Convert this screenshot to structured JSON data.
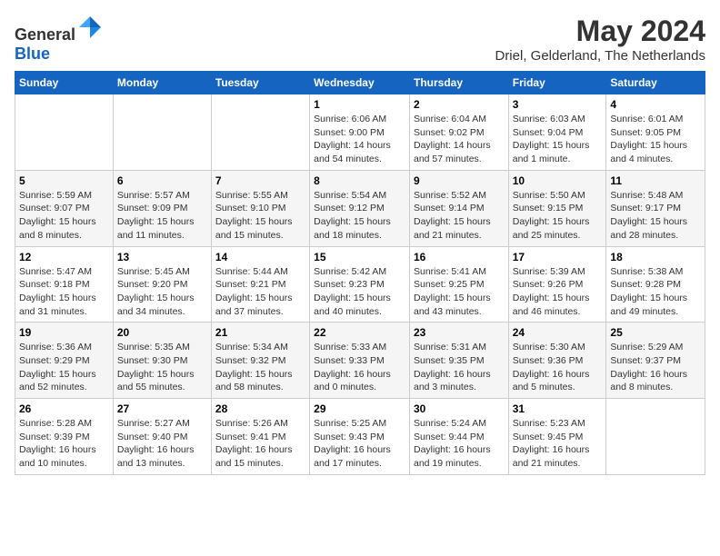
{
  "logo": {
    "general": "General",
    "blue": "Blue"
  },
  "title": "May 2024",
  "location": "Driel, Gelderland, The Netherlands",
  "weekdays": [
    "Sunday",
    "Monday",
    "Tuesday",
    "Wednesday",
    "Thursday",
    "Friday",
    "Saturday"
  ],
  "weeks": [
    [
      {
        "day": "",
        "info": ""
      },
      {
        "day": "",
        "info": ""
      },
      {
        "day": "",
        "info": ""
      },
      {
        "day": "1",
        "info": "Sunrise: 6:06 AM\nSunset: 9:00 PM\nDaylight: 14 hours\nand 54 minutes."
      },
      {
        "day": "2",
        "info": "Sunrise: 6:04 AM\nSunset: 9:02 PM\nDaylight: 14 hours\nand 57 minutes."
      },
      {
        "day": "3",
        "info": "Sunrise: 6:03 AM\nSunset: 9:04 PM\nDaylight: 15 hours\nand 1 minute."
      },
      {
        "day": "4",
        "info": "Sunrise: 6:01 AM\nSunset: 9:05 PM\nDaylight: 15 hours\nand 4 minutes."
      }
    ],
    [
      {
        "day": "5",
        "info": "Sunrise: 5:59 AM\nSunset: 9:07 PM\nDaylight: 15 hours\nand 8 minutes."
      },
      {
        "day": "6",
        "info": "Sunrise: 5:57 AM\nSunset: 9:09 PM\nDaylight: 15 hours\nand 11 minutes."
      },
      {
        "day": "7",
        "info": "Sunrise: 5:55 AM\nSunset: 9:10 PM\nDaylight: 15 hours\nand 15 minutes."
      },
      {
        "day": "8",
        "info": "Sunrise: 5:54 AM\nSunset: 9:12 PM\nDaylight: 15 hours\nand 18 minutes."
      },
      {
        "day": "9",
        "info": "Sunrise: 5:52 AM\nSunset: 9:14 PM\nDaylight: 15 hours\nand 21 minutes."
      },
      {
        "day": "10",
        "info": "Sunrise: 5:50 AM\nSunset: 9:15 PM\nDaylight: 15 hours\nand 25 minutes."
      },
      {
        "day": "11",
        "info": "Sunrise: 5:48 AM\nSunset: 9:17 PM\nDaylight: 15 hours\nand 28 minutes."
      }
    ],
    [
      {
        "day": "12",
        "info": "Sunrise: 5:47 AM\nSunset: 9:18 PM\nDaylight: 15 hours\nand 31 minutes."
      },
      {
        "day": "13",
        "info": "Sunrise: 5:45 AM\nSunset: 9:20 PM\nDaylight: 15 hours\nand 34 minutes."
      },
      {
        "day": "14",
        "info": "Sunrise: 5:44 AM\nSunset: 9:21 PM\nDaylight: 15 hours\nand 37 minutes."
      },
      {
        "day": "15",
        "info": "Sunrise: 5:42 AM\nSunset: 9:23 PM\nDaylight: 15 hours\nand 40 minutes."
      },
      {
        "day": "16",
        "info": "Sunrise: 5:41 AM\nSunset: 9:25 PM\nDaylight: 15 hours\nand 43 minutes."
      },
      {
        "day": "17",
        "info": "Sunrise: 5:39 AM\nSunset: 9:26 PM\nDaylight: 15 hours\nand 46 minutes."
      },
      {
        "day": "18",
        "info": "Sunrise: 5:38 AM\nSunset: 9:28 PM\nDaylight: 15 hours\nand 49 minutes."
      }
    ],
    [
      {
        "day": "19",
        "info": "Sunrise: 5:36 AM\nSunset: 9:29 PM\nDaylight: 15 hours\nand 52 minutes."
      },
      {
        "day": "20",
        "info": "Sunrise: 5:35 AM\nSunset: 9:30 PM\nDaylight: 15 hours\nand 55 minutes."
      },
      {
        "day": "21",
        "info": "Sunrise: 5:34 AM\nSunset: 9:32 PM\nDaylight: 15 hours\nand 58 minutes."
      },
      {
        "day": "22",
        "info": "Sunrise: 5:33 AM\nSunset: 9:33 PM\nDaylight: 16 hours\nand 0 minutes."
      },
      {
        "day": "23",
        "info": "Sunrise: 5:31 AM\nSunset: 9:35 PM\nDaylight: 16 hours\nand 3 minutes."
      },
      {
        "day": "24",
        "info": "Sunrise: 5:30 AM\nSunset: 9:36 PM\nDaylight: 16 hours\nand 5 minutes."
      },
      {
        "day": "25",
        "info": "Sunrise: 5:29 AM\nSunset: 9:37 PM\nDaylight: 16 hours\nand 8 minutes."
      }
    ],
    [
      {
        "day": "26",
        "info": "Sunrise: 5:28 AM\nSunset: 9:39 PM\nDaylight: 16 hours\nand 10 minutes."
      },
      {
        "day": "27",
        "info": "Sunrise: 5:27 AM\nSunset: 9:40 PM\nDaylight: 16 hours\nand 13 minutes."
      },
      {
        "day": "28",
        "info": "Sunrise: 5:26 AM\nSunset: 9:41 PM\nDaylight: 16 hours\nand 15 minutes."
      },
      {
        "day": "29",
        "info": "Sunrise: 5:25 AM\nSunset: 9:43 PM\nDaylight: 16 hours\nand 17 minutes."
      },
      {
        "day": "30",
        "info": "Sunrise: 5:24 AM\nSunset: 9:44 PM\nDaylight: 16 hours\nand 19 minutes."
      },
      {
        "day": "31",
        "info": "Sunrise: 5:23 AM\nSunset: 9:45 PM\nDaylight: 16 hours\nand 21 minutes."
      },
      {
        "day": "",
        "info": ""
      }
    ]
  ]
}
